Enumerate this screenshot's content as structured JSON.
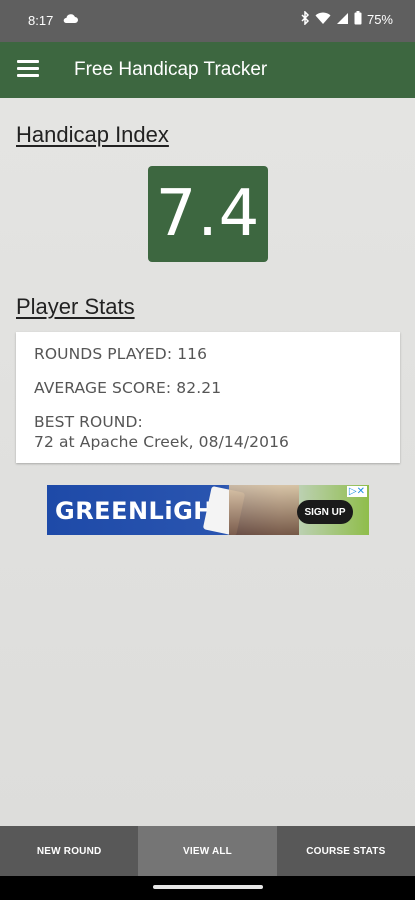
{
  "status_bar": {
    "time": "8:17",
    "battery": "75%",
    "icons": [
      "cloud-icon",
      "bluetooth-icon",
      "wifi-icon",
      "signal-icon",
      "battery-icon"
    ]
  },
  "app_bar": {
    "title": "Free Handicap Tracker",
    "menu_icon": "menu-icon"
  },
  "handicap": {
    "heading": "Handicap Index",
    "value": "7.4"
  },
  "player_stats": {
    "heading": "Player Stats",
    "rounds_played": "ROUNDS PLAYED: 116",
    "average_score": "AVERAGE SCORE: 82.21",
    "best_round_label": "BEST ROUND:",
    "best_round_value": "72 at Apache Creek, 08/14/2016"
  },
  "ad": {
    "brand": "GREENLiGHT",
    "cta": "SIGN UP"
  },
  "bottom_nav": {
    "items": [
      {
        "label": "NEW ROUND",
        "active": false
      },
      {
        "label": "VIEW ALL",
        "active": true
      },
      {
        "label": "COURSE STATS",
        "active": false
      }
    ]
  },
  "colors": {
    "app_bar": "#3d6740",
    "status_bar": "#5f5f5f",
    "bottom_nav": "#585858",
    "bottom_nav_active": "#757575"
  }
}
